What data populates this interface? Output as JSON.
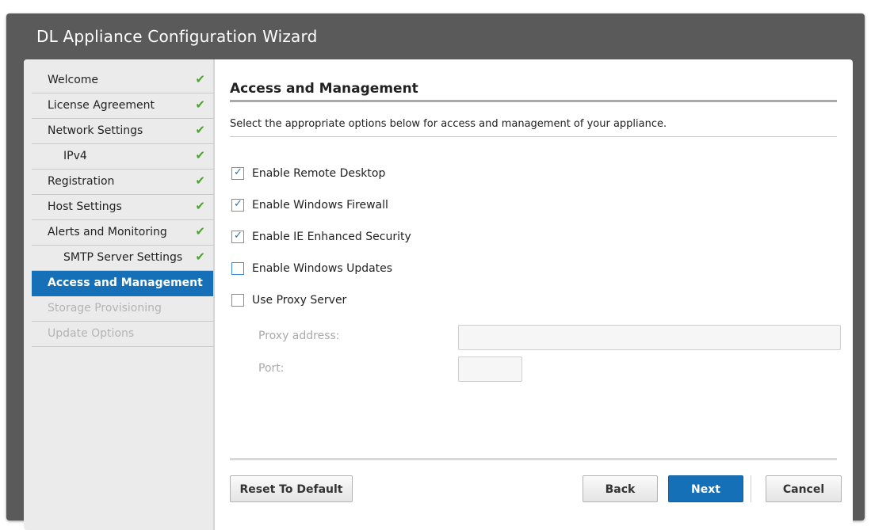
{
  "window": {
    "title": "DL Appliance Configuration Wizard"
  },
  "sidebar": {
    "items": [
      {
        "label": "Welcome",
        "status": "done"
      },
      {
        "label": "License Agreement",
        "status": "done"
      },
      {
        "label": "Network Settings",
        "status": "done"
      },
      {
        "label": "IPv4",
        "status": "done",
        "level": 2
      },
      {
        "label": "Registration",
        "status": "done"
      },
      {
        "label": "Host Settings",
        "status": "done"
      },
      {
        "label": "Alerts and Monitoring",
        "status": "done"
      },
      {
        "label": "SMTP Server Settings",
        "status": "done",
        "level": 2
      },
      {
        "label": "Access and Management",
        "status": "active"
      },
      {
        "label": "Storage Provisioning",
        "status": "disabled"
      },
      {
        "label": "Update Options",
        "status": "disabled"
      }
    ],
    "check_glyph": "✔"
  },
  "main": {
    "heading": "Access and Management",
    "description": "Select the appropriate options below for access and management of your appliance.",
    "options": [
      {
        "label": "Enable Remote Desktop",
        "checked": true
      },
      {
        "label": "Enable Windows Firewall",
        "checked": true
      },
      {
        "label": "Enable IE Enhanced Security",
        "checked": true
      },
      {
        "label": "Enable Windows Updates",
        "checked": false
      },
      {
        "label": "Use Proxy Server",
        "checked": false
      }
    ],
    "check_glyph": "✓",
    "proxy": {
      "address_label": "Proxy address:",
      "address_value": "",
      "port_label": "Port:",
      "port_value": ""
    }
  },
  "footer": {
    "reset_label": "Reset To Default",
    "back_label": "Back",
    "next_label": "Next",
    "cancel_label": "Cancel"
  },
  "colors": {
    "accent": "#1570b8",
    "check": "#52a033",
    "titlebar": "#5a5a5a"
  }
}
